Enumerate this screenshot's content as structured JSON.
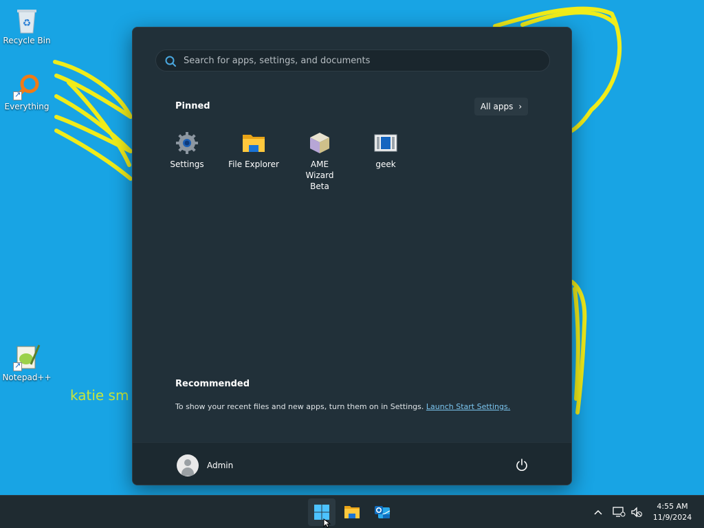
{
  "desktop": {
    "icons": [
      {
        "label": "Recycle Bin",
        "icon": "recycle-bin-icon"
      },
      {
        "label": "Everything",
        "icon": "everything-search-icon"
      },
      {
        "label": "Notepad++",
        "icon": "notepad-plus-plus-icon"
      }
    ],
    "handwritten_text": "katie sm"
  },
  "start_menu": {
    "search_placeholder": "Search for apps, settings, and documents",
    "pinned_title": "Pinned",
    "all_apps_label": "All apps",
    "pinned_apps": [
      {
        "label": "Settings",
        "icon": "gear-icon"
      },
      {
        "label": "File Explorer",
        "icon": "folder-icon"
      },
      {
        "label": "AME Wizard Beta",
        "icon": "cube-icon"
      },
      {
        "label": "geek",
        "icon": "geek-app-icon"
      }
    ],
    "recommended_title": "Recommended",
    "recommended_text": "To show your recent files and new apps, turn them on in Settings.",
    "recommended_link": "Launch Start Settings.",
    "user_name": "Admin"
  },
  "taskbar": {
    "apps": [
      "windows-start-icon",
      "file-explorer-icon",
      "outlook-new-icon"
    ],
    "time": "4:55 AM",
    "date": "11/9/2024"
  },
  "colors": {
    "desktop_bg": "#18a4e4",
    "start_bg": "#213039",
    "taskbar_bg": "#1f2b31",
    "link": "#7cc6f0",
    "scribble": "#f5f01e"
  }
}
